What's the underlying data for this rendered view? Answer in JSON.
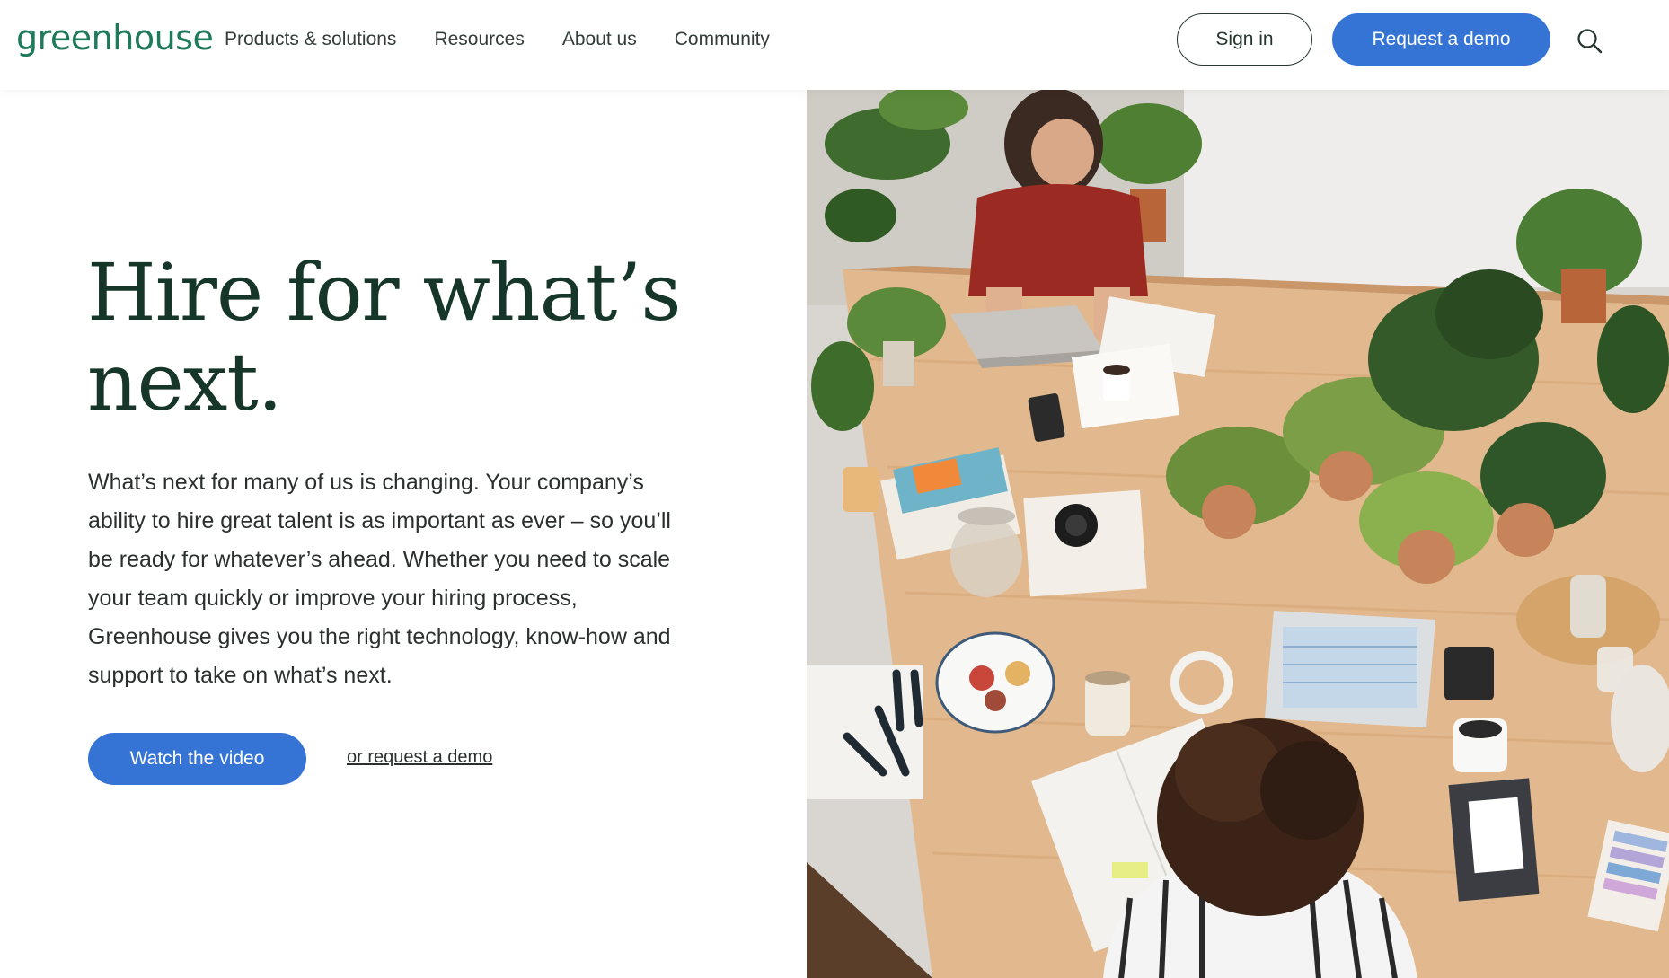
{
  "header": {
    "logo": "greenhouse",
    "nav": [
      {
        "label": "Products & solutions"
      },
      {
        "label": "Resources"
      },
      {
        "label": "About us"
      },
      {
        "label": "Community"
      }
    ],
    "sign_in": "Sign in",
    "request_demo": "Request a demo",
    "search_icon": "search-icon"
  },
  "hero": {
    "title_line1": "Hire for what’s",
    "title_line2": "next.",
    "body": "What’s next for many of us is changing. Your company’s ability to hire great talent is as important as ever – so you’ll be ready for whatever’s ahead. Whether you need to scale your team quickly or improve your hiring process, Greenhouse gives you the right technology, know-how and support to take on what’s next.",
    "primary_cta": "Watch the video",
    "secondary_cta": "or request a demo"
  },
  "colors": {
    "brand_green": "#1f7a5c",
    "heading_green": "#17362a",
    "button_blue": "#3574d4"
  }
}
